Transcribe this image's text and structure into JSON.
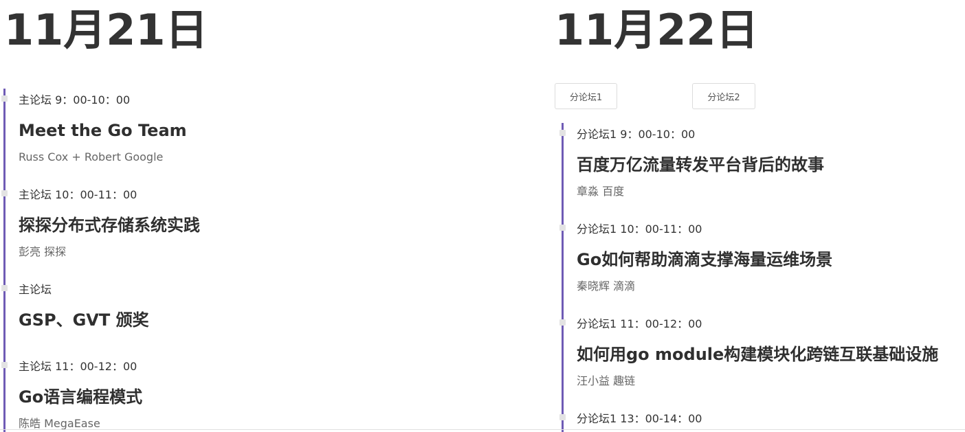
{
  "day1": {
    "title": "11月21日",
    "sessions": [
      {
        "time": "主论坛 9：00-10：00",
        "title": "Meet the Go Team",
        "speaker": "Russ Cox + Robert Google"
      },
      {
        "time": "主论坛 10：00-11：00",
        "title": "探探分布式存储系统实践",
        "speaker": "彭亮 探探"
      },
      {
        "time": "主论坛",
        "title": "GSP、GVT 颁奖",
        "speaker": ""
      },
      {
        "time": "主论坛 11：00-12：00",
        "title": "Go语言编程模式",
        "speaker": "陈皓 MegaEase"
      }
    ]
  },
  "day2": {
    "title": "11月22日",
    "tabs": [
      "分论坛1",
      "分论坛2"
    ],
    "sessions": [
      {
        "time": "分论坛1 9：00-10：00",
        "title": "百度万亿流量转发平台背后的故事",
        "speaker": "章淼 百度"
      },
      {
        "time": "分论坛1 10：00-11：00",
        "title": "Go如何帮助滴滴支撑海量运维场景",
        "speaker": "秦晓辉 滴滴"
      },
      {
        "time": "分论坛1 11：00-12：00",
        "title": "如何用go module构建模块化跨链互联基础设施",
        "speaker": "汪小益 趣链"
      },
      {
        "time": "分论坛1 13：00-14：00",
        "title": "",
        "speaker": ""
      }
    ]
  },
  "colors": {
    "accent": "#6f5bb5",
    "text": "#333333",
    "muted": "#666666"
  }
}
